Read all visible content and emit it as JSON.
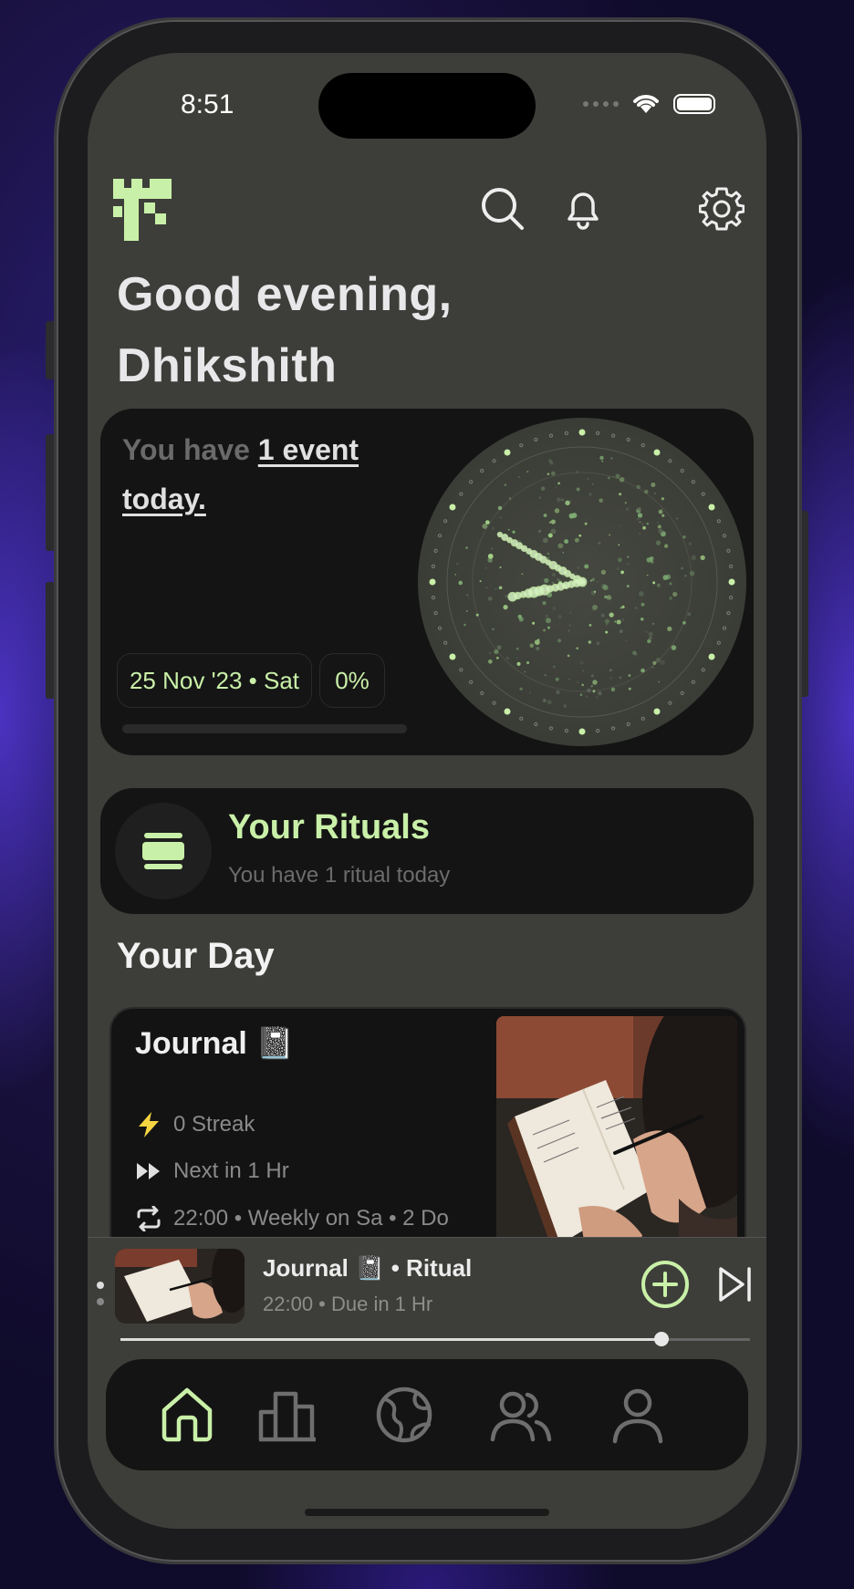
{
  "status_bar": {
    "time": "8:51"
  },
  "header": {
    "greeting_line1": "Good evening,",
    "greeting_line2": "Dhikshith",
    "icons": [
      "logo-icon",
      "search-icon",
      "bell-icon",
      "gear-icon"
    ]
  },
  "event_card": {
    "prefix": "You have ",
    "events_link": "1 event",
    "events_link_tail": "today.",
    "date_chip": "25 Nov '23 • Sat",
    "percent_chip": "0%",
    "progress_fraction": 0.0
  },
  "rituals": {
    "title": "Your Rituals",
    "subtitle": "You have 1 ritual today"
  },
  "your_day": {
    "title": "Your Day",
    "journal": {
      "title": "Journal 📓",
      "streak": "0 Streak",
      "next": "Next in 1 Hr",
      "schedule": "22:00 • Weekly on Sa • 2 Do"
    }
  },
  "player": {
    "title": "Journal 📓  • Ritual",
    "subtitle": "22:00 • Due in 1 Hr",
    "progress_fraction": 0.86
  },
  "tabbar": {
    "tabs": [
      "home",
      "stats",
      "globe",
      "people",
      "profile"
    ],
    "active": "home"
  },
  "colors": {
    "accent": "#c9f0a8",
    "screen_bg": "#3d3e39",
    "card_bg": "#141414",
    "streak": "#f5d442"
  }
}
